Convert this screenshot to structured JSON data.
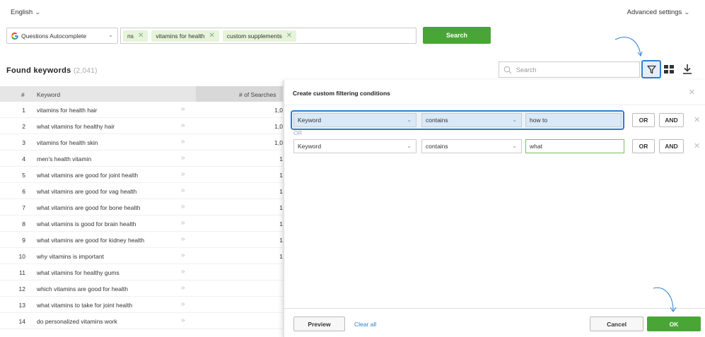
{
  "header": {
    "language": "English",
    "advanced_settings": "Advanced settings"
  },
  "search_bar": {
    "source": "Questions Autocomplete",
    "tags": [
      "ns",
      "vitamins for health",
      "custom supplements"
    ],
    "search_button": "Search"
  },
  "results": {
    "title": "Found keywords",
    "count": "(2,041)",
    "search_placeholder": "Search",
    "columns": {
      "num": "#",
      "keyword": "Keyword",
      "searches": "# of Searches"
    },
    "rows": [
      {
        "num": "1",
        "keyword": "vitamins for health hair",
        "value": "1,0"
      },
      {
        "num": "2",
        "keyword": "what vitamins for healthy hair",
        "value": "1,0"
      },
      {
        "num": "3",
        "keyword": "vitamins for health skin",
        "value": "1,0"
      },
      {
        "num": "4",
        "keyword": "men's health vitamin",
        "value": "1"
      },
      {
        "num": "5",
        "keyword": "what vitamins are good for joint health",
        "value": "1"
      },
      {
        "num": "6",
        "keyword": "what vitamins are good for vag health",
        "value": "1"
      },
      {
        "num": "7",
        "keyword": "what vitamins are good for bone health",
        "value": "1"
      },
      {
        "num": "8",
        "keyword": "what vitamins is good for brain health",
        "value": "1"
      },
      {
        "num": "9",
        "keyword": "what vitamins are good for kidney health",
        "value": "1"
      },
      {
        "num": "10",
        "keyword": "why vitamins is important",
        "value": "1"
      },
      {
        "num": "11",
        "keyword": "what vitamins for healthy gums",
        "value": ""
      },
      {
        "num": "12",
        "keyword": "which vitamins are good for health",
        "value": ""
      },
      {
        "num": "13",
        "keyword": "what vitamins to take for joint health",
        "value": ""
      },
      {
        "num": "14",
        "keyword": "do personalized vitamins work",
        "value": ""
      }
    ]
  },
  "filter_panel": {
    "title": "Create custom filtering conditions",
    "conditions": [
      {
        "field": "Keyword",
        "operator": "contains",
        "value": "how to"
      },
      {
        "field": "Keyword",
        "operator": "contains",
        "value": "what"
      }
    ],
    "or_label": "OR",
    "or_button": "OR",
    "and_button": "AND",
    "preview": "Preview",
    "clear_all": "Clear all",
    "cancel": "Cancel",
    "ok": "OK"
  },
  "colors": {
    "accent_green": "#4aa537",
    "accent_blue": "#2f7fd1",
    "tag_bg": "#e6f4d9"
  }
}
